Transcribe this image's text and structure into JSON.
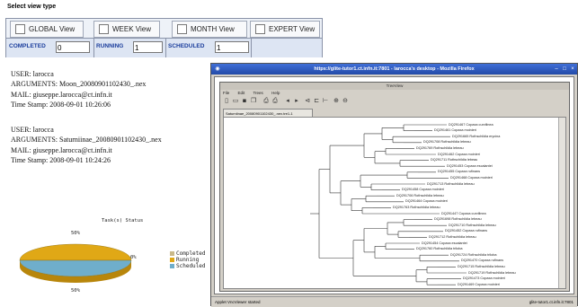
{
  "view_panel": {
    "title": "Select view type",
    "buttons": [
      {
        "label": "GLOBAL View"
      },
      {
        "label": "WEEK View"
      },
      {
        "label": "MONTH View"
      },
      {
        "label": "EXPERT View"
      }
    ],
    "counters": [
      {
        "label": "COMPLETED",
        "value": "0"
      },
      {
        "label": "RUNNING",
        "value": "1"
      },
      {
        "label": "SCHEDULED",
        "value": "1"
      }
    ]
  },
  "jobs": [
    {
      "user": "USER: larocca",
      "arguments": "ARGUMENTS: Moon_20080901102430_.nex",
      "mail": "MAIL: giuseppe.larocca@ct.infn.it",
      "timestamp": "Time Stamp: 2008-09-01 10:26:06"
    },
    {
      "user": "USER: larocca",
      "arguments": "ARGUMENTS: Saturniinae_20080901102430_.nex",
      "mail": "MAIL: giuseppe.larocca@ct.infn.it",
      "timestamp": "Time Stamp: 2008-09-01 10:24:26"
    }
  ],
  "chart_data": {
    "type": "pie",
    "title": "Task(s) Status",
    "categories": [
      "Completed",
      "Running",
      "Scheduled"
    ],
    "values": [
      0,
      50,
      50
    ],
    "slice_labels": [
      "0%",
      "50%",
      "50%"
    ],
    "colors": [
      "#c9b98a",
      "#e0a816",
      "#6faecb"
    ],
    "legend_position": "right"
  },
  "firefox": {
    "title": "https://glite-tutor1.ct.infn.it:7801 - larocca's desktop - Mozilla Firefox",
    "status_text": "Applet VncViewer started",
    "status_host": "glite-tutor1.ct.infn.it:7801",
    "treeview": {
      "title": "TreeView",
      "menu": [
        "File",
        "Edit",
        "Trees",
        "Help"
      ],
      "tab": "Saturniinae_20080901102430_.nex.tre1-1",
      "leaves": [
        "DQ291467 Copaxa curvilinea",
        "DQ291461 Copaxa moinieri",
        "DQ291665 Rothschildia erycina",
        "DQ291708 Rothschildia lebeau",
        "DQ291769 Rothschildia lebeau",
        "DQ291462 Copaxa moinieri",
        "DQ291711 Rothschildia lebeau",
        "DQ291453 Copaxa escalantei",
        "DQ291455 Copaxa rufinans",
        "DQ291468 Copaxa moinieri",
        "DQ291713 Rothschildia lebeau",
        "DQ291458 Copaxa moinieri",
        "DQ291706 Rothschildia lebeau",
        "DQ291464 Copaxa moinieri",
        "DQ291763 Rothschildia lebeau",
        "DQ291447 Copaxa curvilinea",
        "DQ291698 Rothschildia lebeau",
        "DQ291710 Rothschildia lebeau",
        "DQ291452 Copaxa rufinans",
        "DQ291712 Rothschildia lebeau",
        "DQ291454 Copaxa escalantei",
        "DQ291760 Rothschildia triloba",
        "DQ291724 Rothschildia triloba",
        "DQ291470 Copaxa rufinans",
        "DQ291715 Rothschildia lebeau",
        "DQ291719 Rothschildia lebeau",
        "DQ291473 Copaxa moinieri",
        "DQ291469 Copaxa moinieri"
      ]
    }
  }
}
